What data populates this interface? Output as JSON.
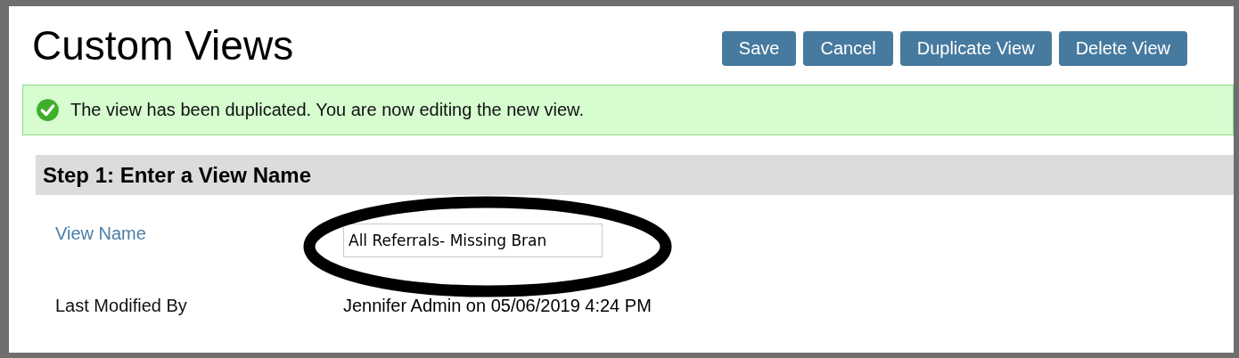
{
  "page": {
    "title": "Custom Views"
  },
  "buttons": [
    "Save",
    "Cancel",
    "Duplicate View",
    "Delete View"
  ],
  "alert": {
    "kind": "success",
    "message": "The view has been duplicated. You are now editing the new view."
  },
  "section": {
    "heading": "Step 1: Enter a View Name"
  },
  "fields": [
    {
      "kind": "input",
      "label": "View Name",
      "value": "All Referrals- Missing Bran"
    },
    {
      "kind": "text",
      "label": "Last Modified By",
      "value": "Jennifer Admin on 05/06/2019 4:24 PM"
    }
  ]
}
